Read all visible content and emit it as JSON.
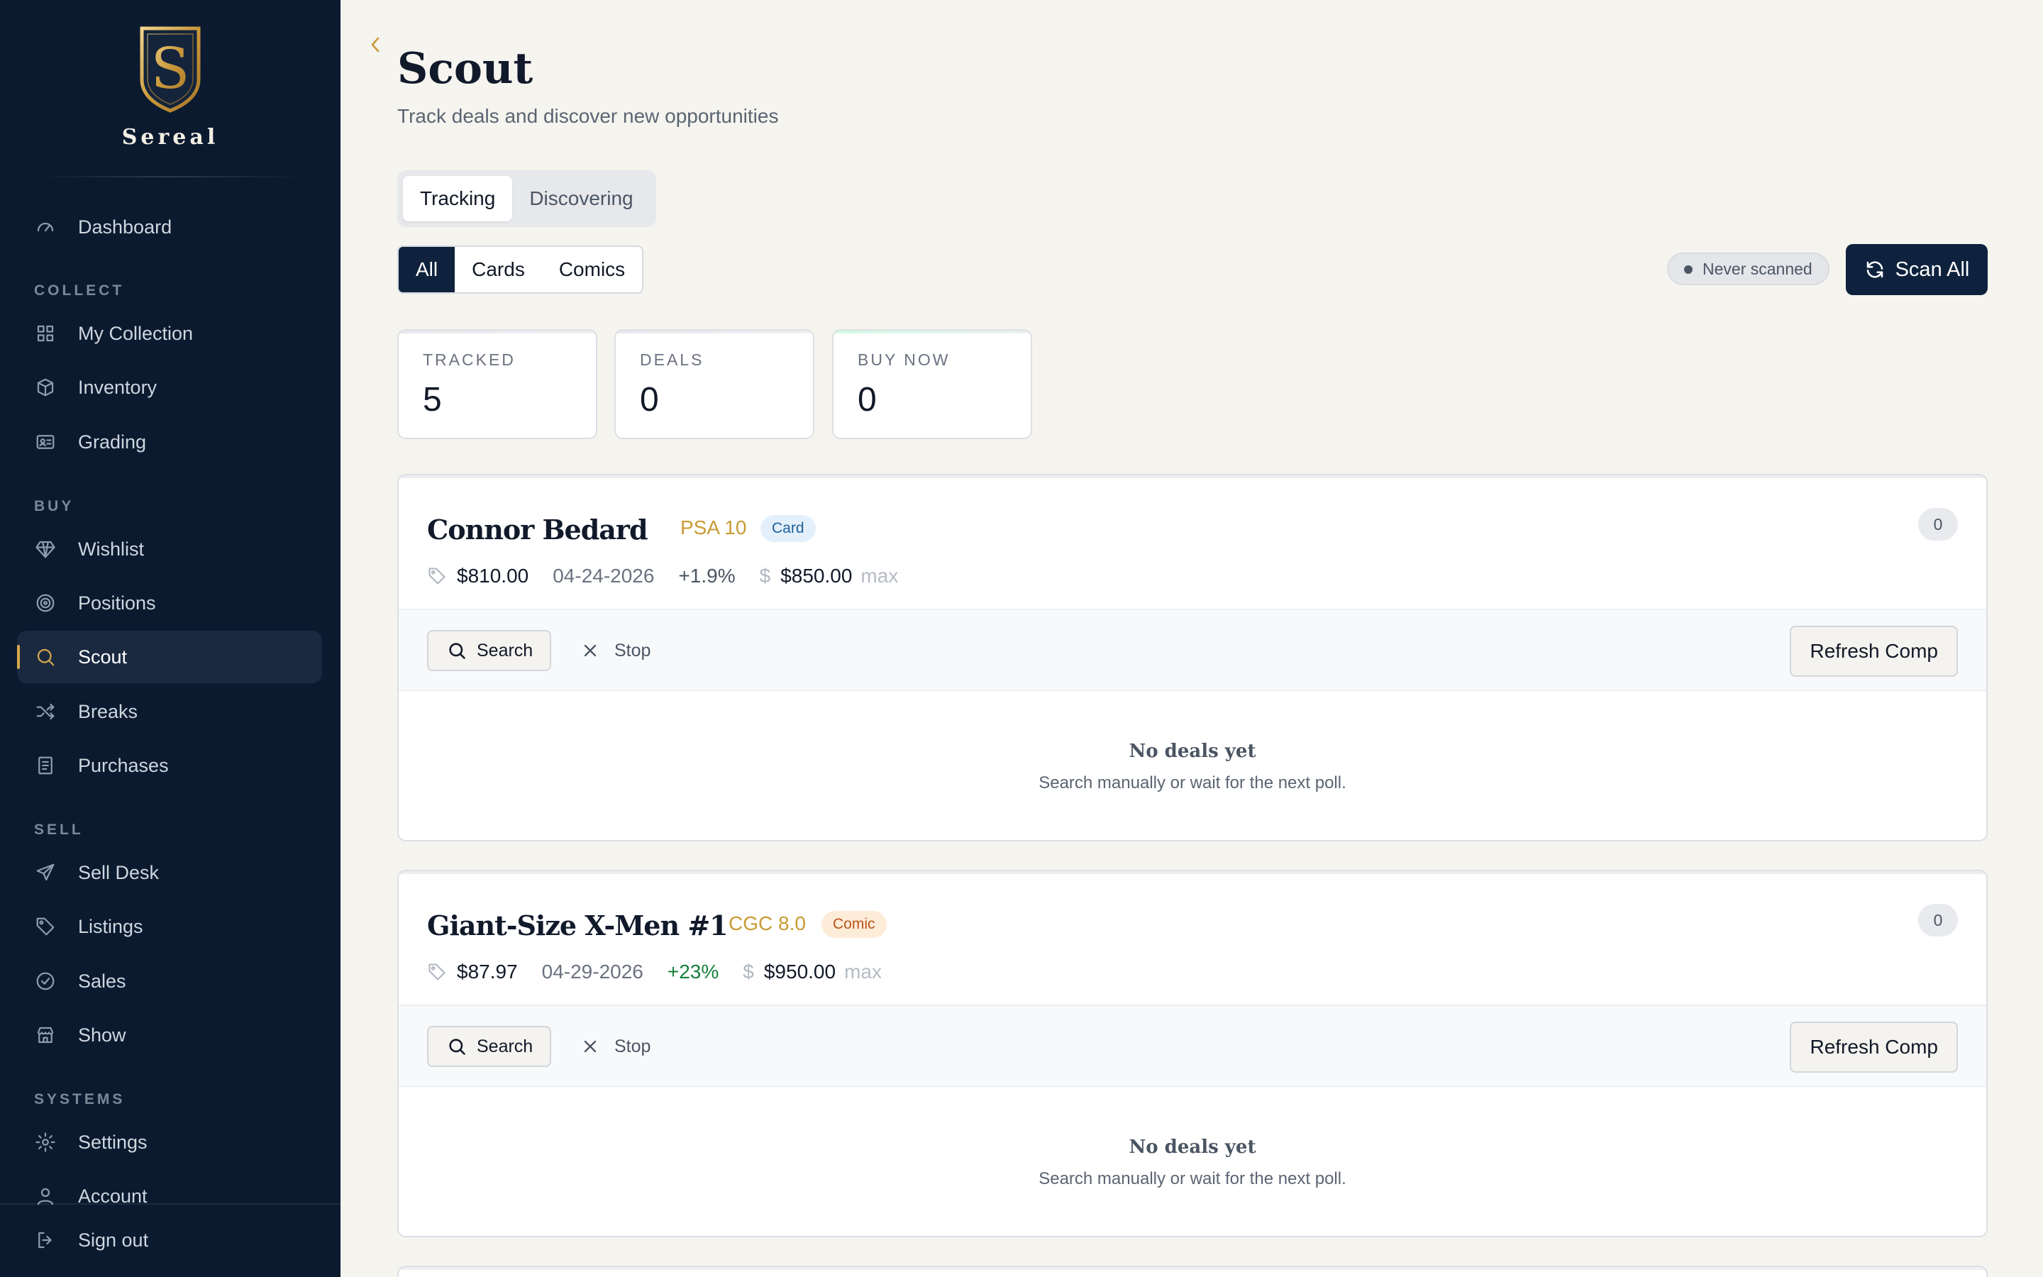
{
  "brand": {
    "name": "Sereal",
    "monogram": "S"
  },
  "nav": {
    "dashboard": "Dashboard",
    "sections": {
      "collect": "COLLECT",
      "buy": "BUY",
      "sell": "SELL",
      "systems": "SYSTEMS"
    },
    "collect": [
      "My Collection",
      "Inventory",
      "Grading"
    ],
    "buy": [
      "Wishlist",
      "Positions",
      "Scout",
      "Breaks",
      "Purchases"
    ],
    "sell": [
      "Sell Desk",
      "Listings",
      "Sales",
      "Show"
    ],
    "systems": [
      "Settings",
      "Account"
    ],
    "sign_out": "Sign out",
    "active": "Scout"
  },
  "page": {
    "title": "Scout",
    "subtitle": "Track deals and discover new opportunities"
  },
  "tabs": [
    {
      "label": "Tracking",
      "active": true
    },
    {
      "label": "Discovering",
      "active": false
    }
  ],
  "filters": [
    {
      "label": "All",
      "active": true
    },
    {
      "label": "Cards",
      "active": false
    },
    {
      "label": "Comics",
      "active": false
    }
  ],
  "scan": {
    "status": "Never scanned",
    "button": "Scan All"
  },
  "stats": [
    {
      "label": "TRACKED",
      "value": "5"
    },
    {
      "label": "DEALS",
      "value": "0"
    },
    {
      "label": "BUY NOW",
      "value": "0"
    }
  ],
  "deals": [
    {
      "name": "Connor Bedard",
      "grade": "PSA 10",
      "type": "Card",
      "count": "0",
      "price": "$810.00",
      "date": "04-24-2026",
      "change": "+1.9%",
      "max_price": "$850.00",
      "max_label": "max",
      "empty_title": "No deals yet",
      "empty_sub": "Search manually or wait for the next poll."
    },
    {
      "name": "Giant-Size X-Men #1",
      "grade": "CGC 8.0",
      "type": "Comic",
      "count": "0",
      "price": "$87.97",
      "date": "04-29-2026",
      "change": "+23%",
      "max_price": "$950.00",
      "max_label": "max",
      "empty_title": "No deals yet",
      "empty_sub": "Search manually or wait for the next poll."
    }
  ],
  "actions": {
    "search": "Search",
    "stop": "Stop",
    "refresh": "Refresh Comp"
  },
  "colors": {
    "sidebar_bg": "#0b1a2f",
    "accent_gold": "#d4a84b",
    "primary_navy": "#0f223d",
    "positive_green": "#15803d",
    "page_bg": "#f5f4ef"
  }
}
